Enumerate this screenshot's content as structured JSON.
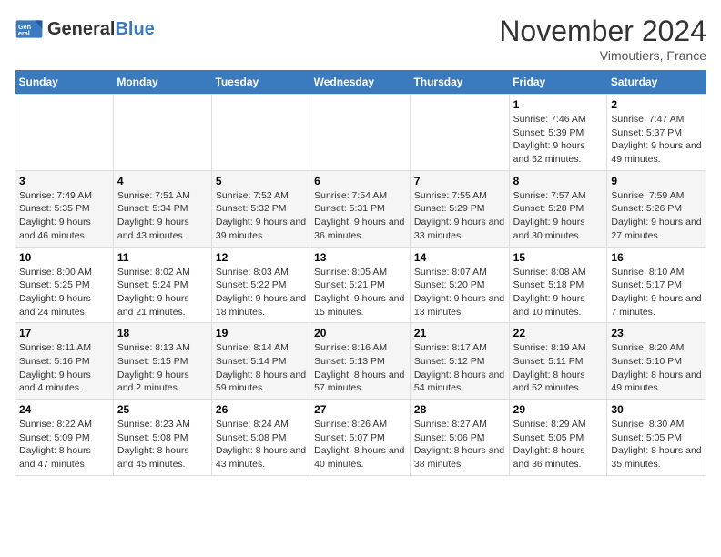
{
  "header": {
    "logo_general": "General",
    "logo_blue": "Blue",
    "month_title": "November 2024",
    "location": "Vimoutiers, France"
  },
  "days_of_week": [
    "Sunday",
    "Monday",
    "Tuesday",
    "Wednesday",
    "Thursday",
    "Friday",
    "Saturday"
  ],
  "weeks": [
    [
      {
        "day": "",
        "info": ""
      },
      {
        "day": "",
        "info": ""
      },
      {
        "day": "",
        "info": ""
      },
      {
        "day": "",
        "info": ""
      },
      {
        "day": "",
        "info": ""
      },
      {
        "day": "1",
        "info": "Sunrise: 7:46 AM\nSunset: 5:39 PM\nDaylight: 9 hours and 52 minutes."
      },
      {
        "day": "2",
        "info": "Sunrise: 7:47 AM\nSunset: 5:37 PM\nDaylight: 9 hours and 49 minutes."
      }
    ],
    [
      {
        "day": "3",
        "info": "Sunrise: 7:49 AM\nSunset: 5:35 PM\nDaylight: 9 hours and 46 minutes."
      },
      {
        "day": "4",
        "info": "Sunrise: 7:51 AM\nSunset: 5:34 PM\nDaylight: 9 hours and 43 minutes."
      },
      {
        "day": "5",
        "info": "Sunrise: 7:52 AM\nSunset: 5:32 PM\nDaylight: 9 hours and 39 minutes."
      },
      {
        "day": "6",
        "info": "Sunrise: 7:54 AM\nSunset: 5:31 PM\nDaylight: 9 hours and 36 minutes."
      },
      {
        "day": "7",
        "info": "Sunrise: 7:55 AM\nSunset: 5:29 PM\nDaylight: 9 hours and 33 minutes."
      },
      {
        "day": "8",
        "info": "Sunrise: 7:57 AM\nSunset: 5:28 PM\nDaylight: 9 hours and 30 minutes."
      },
      {
        "day": "9",
        "info": "Sunrise: 7:59 AM\nSunset: 5:26 PM\nDaylight: 9 hours and 27 minutes."
      }
    ],
    [
      {
        "day": "10",
        "info": "Sunrise: 8:00 AM\nSunset: 5:25 PM\nDaylight: 9 hours and 24 minutes."
      },
      {
        "day": "11",
        "info": "Sunrise: 8:02 AM\nSunset: 5:24 PM\nDaylight: 9 hours and 21 minutes."
      },
      {
        "day": "12",
        "info": "Sunrise: 8:03 AM\nSunset: 5:22 PM\nDaylight: 9 hours and 18 minutes."
      },
      {
        "day": "13",
        "info": "Sunrise: 8:05 AM\nSunset: 5:21 PM\nDaylight: 9 hours and 15 minutes."
      },
      {
        "day": "14",
        "info": "Sunrise: 8:07 AM\nSunset: 5:20 PM\nDaylight: 9 hours and 13 minutes."
      },
      {
        "day": "15",
        "info": "Sunrise: 8:08 AM\nSunset: 5:18 PM\nDaylight: 9 hours and 10 minutes."
      },
      {
        "day": "16",
        "info": "Sunrise: 8:10 AM\nSunset: 5:17 PM\nDaylight: 9 hours and 7 minutes."
      }
    ],
    [
      {
        "day": "17",
        "info": "Sunrise: 8:11 AM\nSunset: 5:16 PM\nDaylight: 9 hours and 4 minutes."
      },
      {
        "day": "18",
        "info": "Sunrise: 8:13 AM\nSunset: 5:15 PM\nDaylight: 9 hours and 2 minutes."
      },
      {
        "day": "19",
        "info": "Sunrise: 8:14 AM\nSunset: 5:14 PM\nDaylight: 8 hours and 59 minutes."
      },
      {
        "day": "20",
        "info": "Sunrise: 8:16 AM\nSunset: 5:13 PM\nDaylight: 8 hours and 57 minutes."
      },
      {
        "day": "21",
        "info": "Sunrise: 8:17 AM\nSunset: 5:12 PM\nDaylight: 8 hours and 54 minutes."
      },
      {
        "day": "22",
        "info": "Sunrise: 8:19 AM\nSunset: 5:11 PM\nDaylight: 8 hours and 52 minutes."
      },
      {
        "day": "23",
        "info": "Sunrise: 8:20 AM\nSunset: 5:10 PM\nDaylight: 8 hours and 49 minutes."
      }
    ],
    [
      {
        "day": "24",
        "info": "Sunrise: 8:22 AM\nSunset: 5:09 PM\nDaylight: 8 hours and 47 minutes."
      },
      {
        "day": "25",
        "info": "Sunrise: 8:23 AM\nSunset: 5:08 PM\nDaylight: 8 hours and 45 minutes."
      },
      {
        "day": "26",
        "info": "Sunrise: 8:24 AM\nSunset: 5:08 PM\nDaylight: 8 hours and 43 minutes."
      },
      {
        "day": "27",
        "info": "Sunrise: 8:26 AM\nSunset: 5:07 PM\nDaylight: 8 hours and 40 minutes."
      },
      {
        "day": "28",
        "info": "Sunrise: 8:27 AM\nSunset: 5:06 PM\nDaylight: 8 hours and 38 minutes."
      },
      {
        "day": "29",
        "info": "Sunrise: 8:29 AM\nSunset: 5:05 PM\nDaylight: 8 hours and 36 minutes."
      },
      {
        "day": "30",
        "info": "Sunrise: 8:30 AM\nSunset: 5:05 PM\nDaylight: 8 hours and 35 minutes."
      }
    ]
  ]
}
